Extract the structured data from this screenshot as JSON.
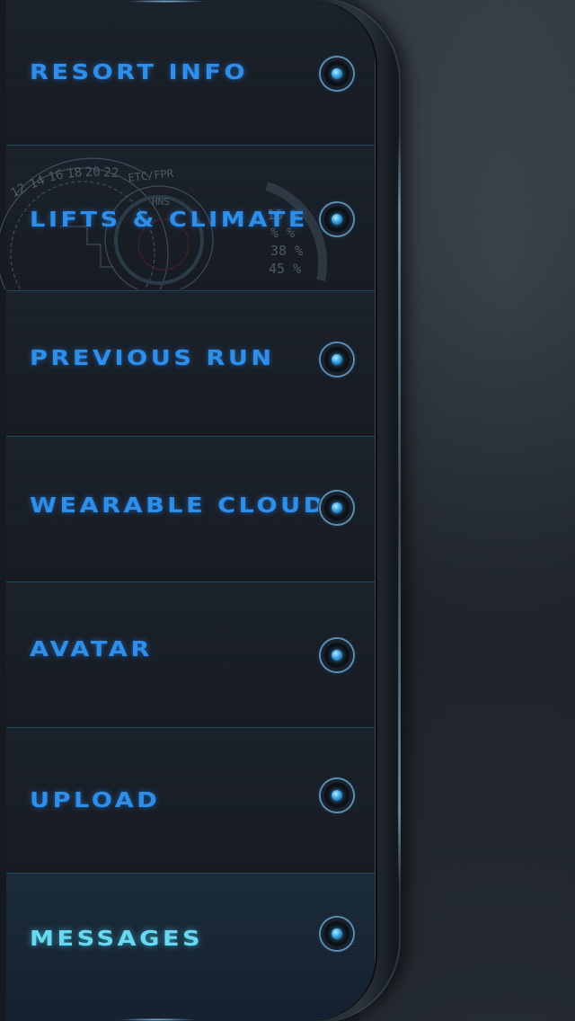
{
  "menu": {
    "items": [
      {
        "label": "Resort Info",
        "active": false
      },
      {
        "label": "Lifts & Climate",
        "active": false
      },
      {
        "label": "Previous Run",
        "active": false
      },
      {
        "label": "Wearable Cloud",
        "active": false
      },
      {
        "label": "Avatar",
        "active": false
      },
      {
        "label": "Upload",
        "active": false
      },
      {
        "label": "Messages",
        "active": true
      }
    ]
  },
  "hud": {
    "scale_labels": [
      "12",
      "14",
      "16",
      "18",
      "20",
      "22"
    ],
    "code_top": "ETC/FPR",
    "code_sub": "HNS",
    "percents": [
      "16 %",
      "% %",
      "38 %",
      "45 %"
    ]
  },
  "colors": {
    "label": "#2f8fe8",
    "active_label": "#6ad8f0",
    "divider": "#1f4a5c",
    "knob_ring": "#5a8fb3"
  },
  "icons": {
    "item_indicator": "radio-knob-icon",
    "hud_decoration": "hud-gauge-icon"
  }
}
